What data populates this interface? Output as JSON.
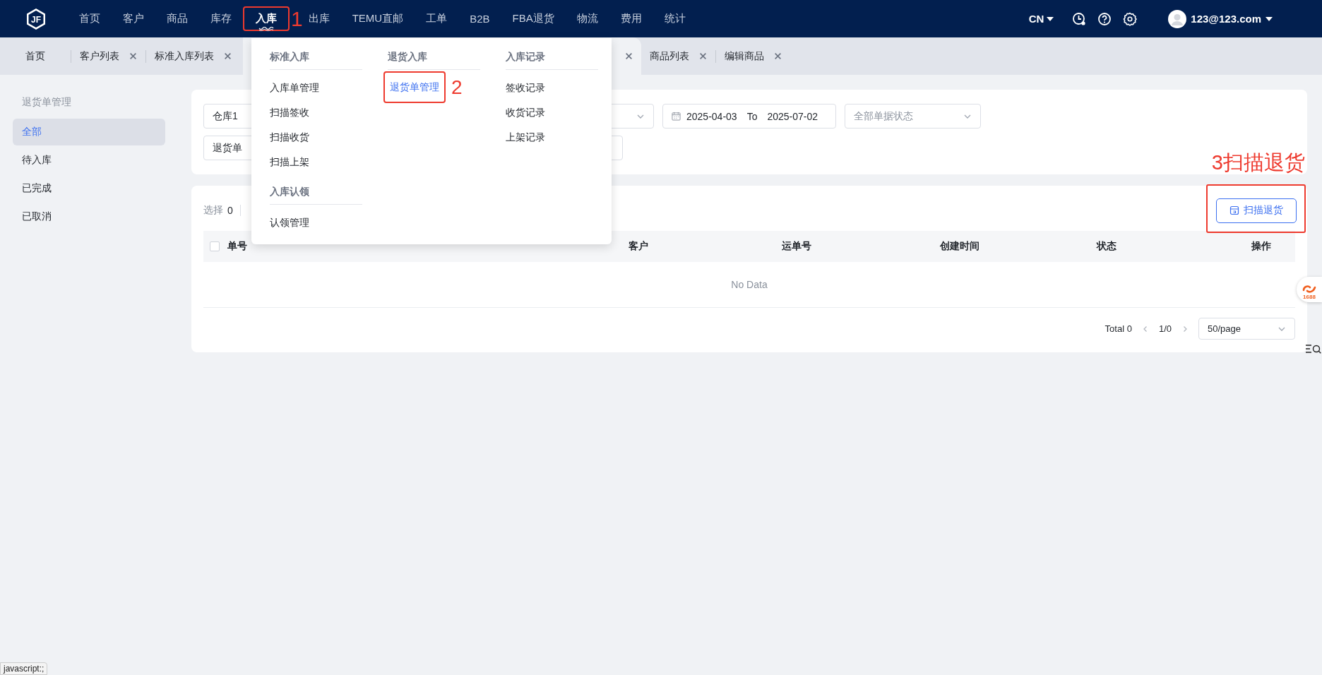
{
  "header": {
    "logo_text": "JF",
    "nav": [
      {
        "label": "首页",
        "selected": false
      },
      {
        "label": "客户",
        "selected": false
      },
      {
        "label": "商品",
        "selected": false
      },
      {
        "label": "库存",
        "selected": false
      },
      {
        "label": "入库",
        "selected": true,
        "marked": true,
        "callout": "1"
      },
      {
        "label": "出库",
        "selected": false
      },
      {
        "label": "TEMU直邮",
        "selected": false
      },
      {
        "label": "工单",
        "selected": false
      },
      {
        "label": "B2B",
        "selected": false
      },
      {
        "label": "FBA退货",
        "selected": false
      },
      {
        "label": "物流",
        "selected": false
      },
      {
        "label": "费用",
        "selected": false
      },
      {
        "label": "统计",
        "selected": false
      }
    ],
    "language": "CN",
    "user": "123@123.com"
  },
  "tabs": [
    {
      "label": "首页",
      "selected": false,
      "closable": false
    },
    {
      "label": "客户列表",
      "selected": false,
      "closable": true
    },
    {
      "label": "标准入库列表",
      "selected": false,
      "closable": true
    },
    {
      "selected": true,
      "closable": true
    },
    {
      "label": "商品列表",
      "selected": false,
      "closable": true
    },
    {
      "label": "编辑商品",
      "selected": false,
      "closable": true
    }
  ],
  "menu": {
    "columns": [
      {
        "groups": [
          {
            "title": "标准入库",
            "items": [
              {
                "label": "入库单管理",
                "selected": false
              },
              {
                "label": "扫描签收",
                "selected": false
              },
              {
                "label": "扫描收货",
                "selected": false
              },
              {
                "label": "扫描上架",
                "selected": false
              }
            ]
          },
          {
            "title": "入库认领",
            "items": [
              {
                "label": "认领管理",
                "selected": false
              }
            ]
          }
        ]
      },
      {
        "groups": [
          {
            "title": "退货入库",
            "items": [
              {
                "label": "退货单管理",
                "selected": true,
                "marked": true,
                "callout": "2"
              }
            ]
          }
        ]
      },
      {
        "groups": [
          {
            "title": "入库记录",
            "items": [
              {
                "label": "签收记录",
                "selected": false
              },
              {
                "label": "收货记录",
                "selected": false
              },
              {
                "label": "上架记录",
                "selected": false
              }
            ]
          }
        ]
      }
    ]
  },
  "sidebar": {
    "title": "退货单管理",
    "items": [
      {
        "label": "全部",
        "selected": true
      },
      {
        "label": "待入库",
        "selected": false
      },
      {
        "label": "已完成",
        "selected": false
      },
      {
        "label": "已取消",
        "selected": false
      }
    ]
  },
  "filters": {
    "rows": [
      [
        {
          "kind": "field",
          "value": "仓库1"
        },
        {
          "kind": "select"
        },
        {
          "kind": "date_range",
          "start": "2025-04-03",
          "separator": "To",
          "end": "2025-07-02"
        },
        {
          "kind": "select",
          "placeholder": "全部单据状态"
        }
      ],
      [
        {
          "kind": "field",
          "value": "退货单"
        },
        {
          "kind": "input"
        }
      ]
    ]
  },
  "table": {
    "selection_label": "选择",
    "selection_count": "0",
    "action": {
      "label": "扫描退货",
      "marked": true,
      "callout": "3扫描退货"
    },
    "header_checkbox": {
      "checked": false
    },
    "columns": [
      "单号",
      "客户",
      "运单号",
      "创建时间",
      "状态",
      "操作"
    ],
    "empty_text": "No Data",
    "pagination": {
      "total": "Total 0",
      "page": "1/0",
      "page_size": "50/page"
    }
  },
  "floating_badge": "1688",
  "status_tooltip": "javascript:;"
}
